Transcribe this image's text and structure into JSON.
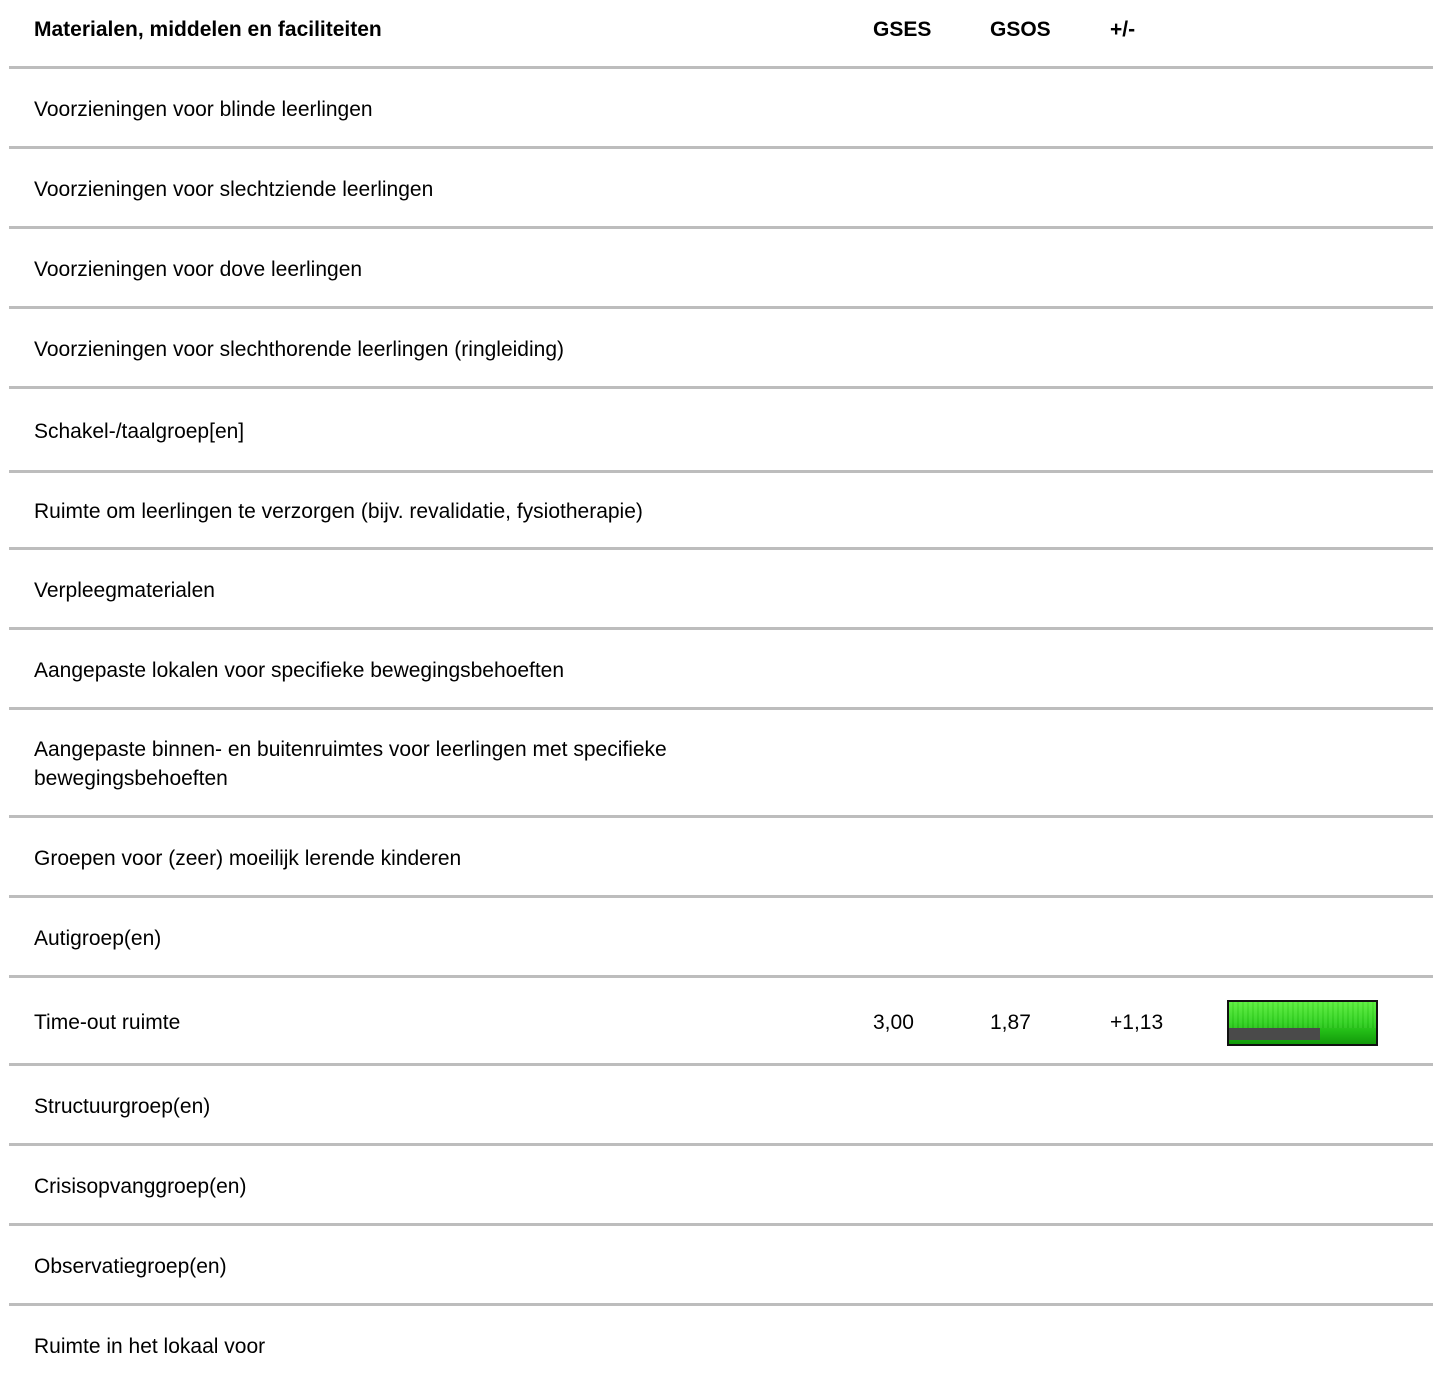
{
  "header": {
    "title": "Materialen, middelen en faciliteiten",
    "col_gses": "GSES",
    "col_gsos": "GSOS",
    "col_diff": "+/-"
  },
  "rows": [
    {
      "label": "Voorzieningen voor blinde leerlingen"
    },
    {
      "label": "Voorzieningen voor slechtziende leerlingen"
    },
    {
      "label": "Voorzieningen voor dove leerlingen"
    },
    {
      "label": "Voorzieningen voor slechthorende leerlingen (ringleiding)"
    },
    {
      "label": "Schakel-/taalgroep[en]"
    },
    {
      "label": "Ruimte om leerlingen te verzorgen (bijv. revalidatie, fysiotherapie)"
    },
    {
      "label": "Verpleegmaterialen"
    },
    {
      "label": "Aangepaste lokalen voor specifieke bewegingsbehoeften"
    },
    {
      "label": "Aangepaste binnen- en buitenruimtes voor leerlingen met specifieke bewegingsbehoeften"
    },
    {
      "label": "Groepen voor (zeer) moeilijk lerende kinderen"
    },
    {
      "label": "Autigroep(en)"
    },
    {
      "label": "Time-out ruimte",
      "gses": "3,00",
      "gsos": "1,87",
      "diff": "+1,13",
      "bar_gses_fraction": 1.0,
      "bar_gsos_fraction": 0.62,
      "bar_color": "#2ed11e"
    },
    {
      "label": "Structuurgroep(en)"
    },
    {
      "label": "Crisisopvanggroep(en)"
    },
    {
      "label": "Observatiegroep(en)"
    },
    {
      "label": "Ruimte in het lokaal voor"
    }
  ]
}
